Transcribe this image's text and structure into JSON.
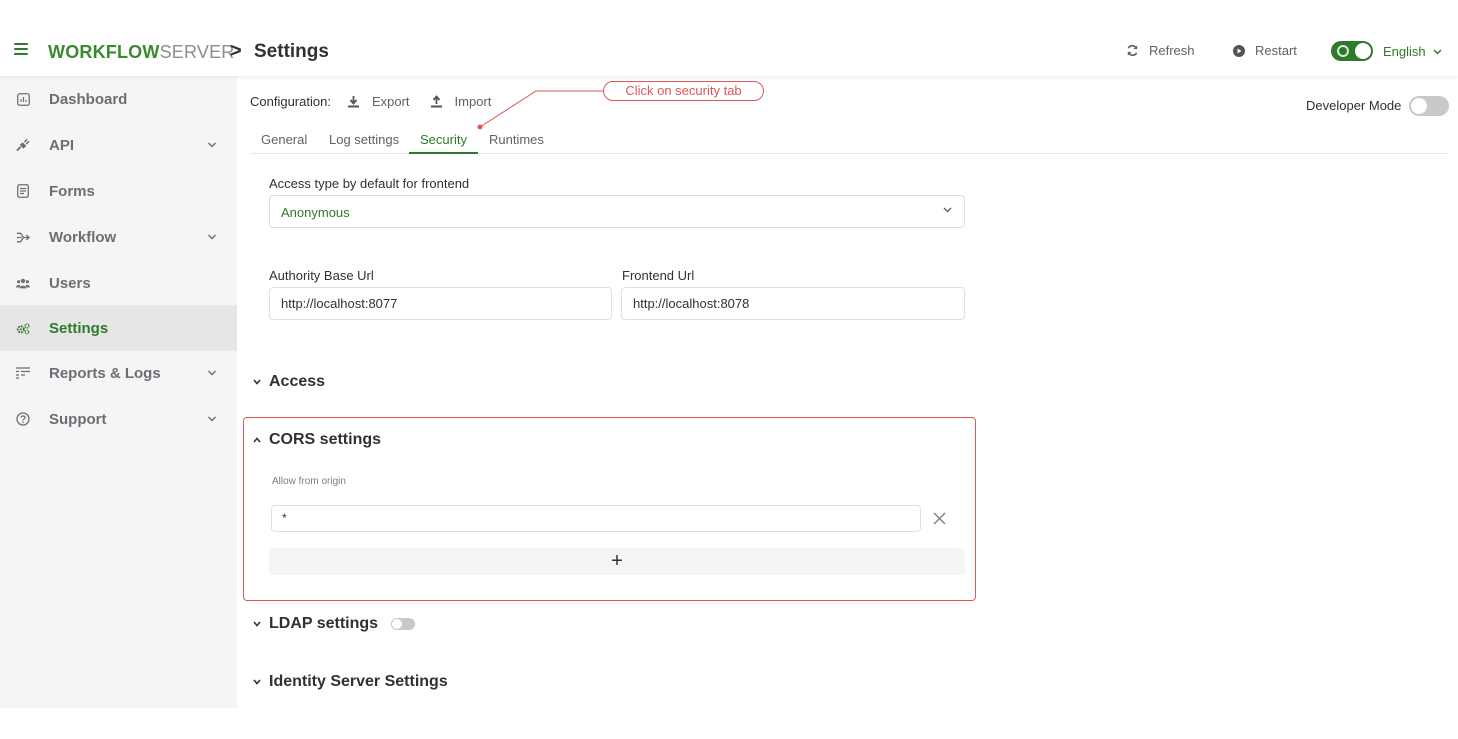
{
  "header": {
    "logo_bold": "WORKFLOW",
    "logo_light": "SERVER",
    "breadcrumb_separator": ">",
    "title": "Settings",
    "refresh_label": "Refresh",
    "restart_label": "Restart",
    "language": "English"
  },
  "sidebar": {
    "items": [
      {
        "label": "Dashboard",
        "icon": "dashboard-icon",
        "has_chevron": false
      },
      {
        "label": "API",
        "icon": "plug-icon",
        "has_chevron": true
      },
      {
        "label": "Forms",
        "icon": "form-icon",
        "has_chevron": false
      },
      {
        "label": "Workflow",
        "icon": "workflow-icon",
        "has_chevron": true
      },
      {
        "label": "Users",
        "icon": "users-icon",
        "has_chevron": false
      },
      {
        "label": "Settings",
        "icon": "gears-icon",
        "has_chevron": false,
        "active": true
      },
      {
        "label": "Reports & Logs",
        "icon": "reports-icon",
        "has_chevron": true
      },
      {
        "label": "Support",
        "icon": "help-icon",
        "has_chevron": true
      }
    ]
  },
  "toolbar": {
    "configuration_label": "Configuration:",
    "export_label": "Export",
    "import_label": "Import",
    "developer_mode_label": "Developer Mode"
  },
  "annotation": {
    "callout": "Click on security tab"
  },
  "tabs": [
    {
      "label": "General"
    },
    {
      "label": "Log settings"
    },
    {
      "label": "Security",
      "active": true
    },
    {
      "label": "Runtimes"
    }
  ],
  "security": {
    "access_type_label": "Access type by default for frontend",
    "access_type_value": "Anonymous",
    "authority_label": "Authority Base Url",
    "authority_value": "http://localhost:8077",
    "frontend_label": "Frontend Url",
    "frontend_value": "http://localhost:8078"
  },
  "sections": {
    "access": "Access",
    "cors": "CORS settings",
    "ldap": "LDAP settings",
    "identity": "Identity Server Settings"
  },
  "cors": {
    "allow_origin_label": "Allow from origin",
    "origin_value": "*",
    "add_label": "+"
  },
  "colors": {
    "accent": "#2f7a2a",
    "annotation": "#e05656"
  }
}
